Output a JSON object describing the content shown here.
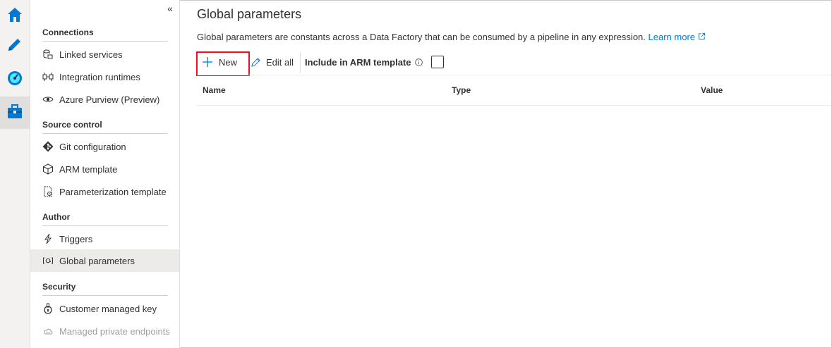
{
  "rail": {
    "items": [
      {
        "icon": "home-icon"
      },
      {
        "icon": "pencil-icon"
      },
      {
        "icon": "monitor-gauge-icon"
      },
      {
        "icon": "toolbox-icon",
        "active": true
      }
    ]
  },
  "nav": {
    "collapse_glyph": "«",
    "sections": [
      {
        "title": "Connections",
        "items": [
          {
            "label": "Linked services",
            "icon": "linked-services-icon"
          },
          {
            "label": "Integration runtimes",
            "icon": "integration-runtime-icon"
          },
          {
            "label": "Azure Purview (Preview)",
            "icon": "eye-icon"
          }
        ]
      },
      {
        "title": "Source control",
        "items": [
          {
            "label": "Git configuration",
            "icon": "git-icon"
          },
          {
            "label": "ARM template",
            "icon": "cube-icon"
          },
          {
            "label": "Parameterization template",
            "icon": "document-gear-icon"
          }
        ]
      },
      {
        "title": "Author",
        "items": [
          {
            "label": "Triggers",
            "icon": "lightning-icon"
          },
          {
            "label": "Global parameters",
            "icon": "global-parameters-icon",
            "selected": true
          }
        ]
      },
      {
        "title": "Security",
        "items": [
          {
            "label": "Customer managed key",
            "icon": "key-icon"
          },
          {
            "label": "Managed private endpoints",
            "icon": "cloud-icon",
            "disabled": true
          }
        ]
      }
    ]
  },
  "main": {
    "title": "Global parameters",
    "description": "Global parameters are constants across a Data Factory that can be consumed by a pipeline in any expression.",
    "learn_more": "Learn more",
    "toolbar": {
      "new_label": "New",
      "edit_all_label": "Edit all",
      "include_arm_label": "Include in ARM template",
      "include_arm_checked": false
    },
    "table": {
      "columns": [
        "Name",
        "Type",
        "Value"
      ],
      "rows": []
    }
  },
  "colors": {
    "accent": "#0078d4",
    "highlight_border": "#e81123",
    "rail_bg": "#f3f2f1",
    "selected_bg": "#edebe9"
  }
}
